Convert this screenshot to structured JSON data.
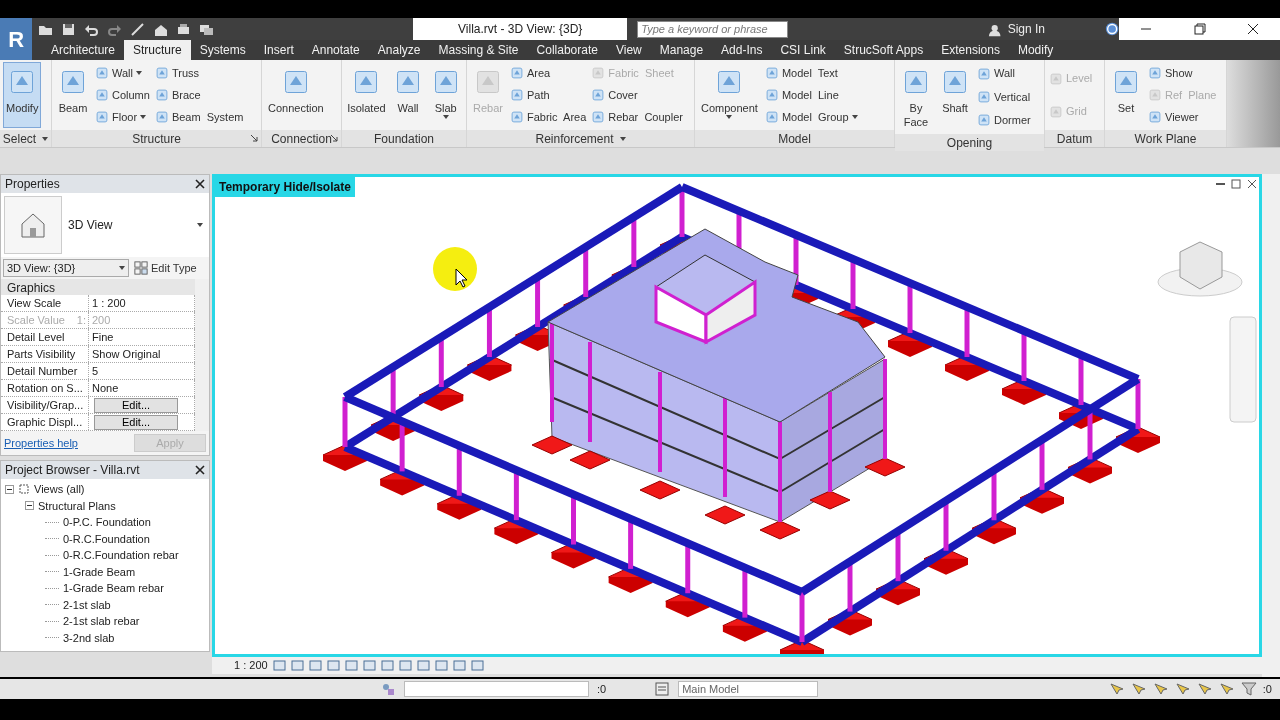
{
  "title_bar": {
    "app_logo": "R",
    "title": "Villa.rvt - 3D View: {3D}",
    "search": {
      "placeholder": "Type a keyword or phrase"
    },
    "sign_in": "Sign In"
  },
  "ribbon_tabs": [
    {
      "label": "Architecture",
      "selected": false
    },
    {
      "label": "Structure",
      "selected": true
    },
    {
      "label": "Systems",
      "selected": false
    },
    {
      "label": "Insert",
      "selected": false
    },
    {
      "label": "Annotate",
      "selected": false
    },
    {
      "label": "Analyze",
      "selected": false
    },
    {
      "label": "Massing & Site",
      "selected": false
    },
    {
      "label": "Collaborate",
      "selected": false
    },
    {
      "label": "View",
      "selected": false
    },
    {
      "label": "Manage",
      "selected": false
    },
    {
      "label": "Add-Ins",
      "selected": false
    },
    {
      "label": "CSI Link",
      "selected": false
    },
    {
      "label": "StrucSoft Apps",
      "selected": false
    },
    {
      "label": "Extensions",
      "selected": false
    },
    {
      "label": "Modify",
      "selected": false
    }
  ],
  "ribbon_panels": [
    {
      "title": "Select",
      "menu": true,
      "tools": [
        {
          "label": "Modify",
          "kind": "large",
          "selected": true
        }
      ]
    },
    {
      "title": "Structure",
      "launcher": true,
      "tools": [
        {
          "label": "Beam",
          "kind": "large"
        },
        {
          "label": "Wall",
          "kind": "small",
          "dropdown": true
        },
        {
          "label": "Column",
          "kind": "small"
        },
        {
          "label": "Floor",
          "kind": "small",
          "dropdown": true
        },
        {
          "label": "Truss",
          "kind": "small"
        },
        {
          "label": "Brace",
          "kind": "small"
        },
        {
          "label": "Beam  System",
          "kind": "small"
        }
      ]
    },
    {
      "title": "Connection",
      "launcher": true,
      "tools": [
        {
          "label": "Connection",
          "kind": "large"
        }
      ]
    },
    {
      "title": "Foundation",
      "tools": [
        {
          "label": "Isolated",
          "kind": "large"
        },
        {
          "label": "Wall",
          "kind": "large"
        },
        {
          "label": "Slab",
          "kind": "large",
          "dropdown": true
        }
      ]
    },
    {
      "title": "Reinforcement",
      "menu": true,
      "tools": [
        {
          "label": "Rebar",
          "kind": "large",
          "disabled": true
        },
        {
          "label": "Area",
          "kind": "small"
        },
        {
          "label": "Path",
          "kind": "small"
        },
        {
          "label": "Fabric  Area",
          "kind": "small"
        },
        {
          "label": "Fabric  Sheet",
          "kind": "small",
          "disabled": true
        },
        {
          "label": "Cover",
          "kind": "small"
        },
        {
          "label": "Rebar  Coupler",
          "kind": "small"
        }
      ]
    },
    {
      "title": "Model",
      "tools": [
        {
          "label": "Component",
          "kind": "large",
          "dropdown": true
        },
        {
          "label": "Model  Text",
          "kind": "small"
        },
        {
          "label": "Model  Line",
          "kind": "small"
        },
        {
          "label": "Model  Group",
          "kind": "small",
          "dropdown": true
        }
      ]
    },
    {
      "title": "Opening",
      "tools": [
        {
          "label": "By Face",
          "kind": "large"
        },
        {
          "label": "Shaft",
          "kind": "large"
        },
        {
          "label": "Wall",
          "kind": "small"
        },
        {
          "label": "Vertical",
          "kind": "small"
        },
        {
          "label": "Dormer",
          "kind": "small"
        }
      ]
    },
    {
      "title": "Datum",
      "tools": [
        {
          "label": "Level",
          "kind": "small",
          "disabled": true
        },
        {
          "label": "Grid",
          "kind": "small",
          "disabled": true
        }
      ]
    },
    {
      "title": "Work Plane",
      "tools": [
        {
          "label": "Set",
          "kind": "large"
        },
        {
          "label": "Show",
          "kind": "small"
        },
        {
          "label": "Ref  Plane",
          "kind": "small",
          "disabled": true
        },
        {
          "label": "Viewer",
          "kind": "small"
        }
      ]
    }
  ],
  "properties": {
    "title": "Properties",
    "type_name": "3D View",
    "type_selector": "3D View: {3D}",
    "edit_type": "Edit Type",
    "group": "Graphics",
    "rows": [
      {
        "name": "View Scale",
        "value": "1 : 200",
        "kind": "text",
        "disabled": false
      },
      {
        "name": "Scale Value",
        "unit": "1:",
        "value": "200",
        "kind": "text",
        "disabled": true
      },
      {
        "name": "Detail Level",
        "value": "Fine",
        "kind": "text",
        "disabled": false
      },
      {
        "name": "Parts Visibility",
        "value": "Show Original",
        "kind": "text",
        "disabled": false
      },
      {
        "name": "Detail Number",
        "value": "5",
        "kind": "text",
        "disabled": false
      },
      {
        "name": "Rotation on S...",
        "value": "None",
        "kind": "text",
        "disabled": false
      },
      {
        "name": "Visibility/Grap...",
        "value": "Edit...",
        "kind": "button",
        "disabled": false
      },
      {
        "name": "Graphic Displ...",
        "value": "Edit...",
        "kind": "button",
        "disabled": false
      }
    ],
    "help_link": "Properties help",
    "apply": {
      "label": "Apply",
      "disabled": true
    }
  },
  "project_browser": {
    "title": "Project Browser - Villa.rvt",
    "tree": [
      {
        "label": "Views (all)",
        "expanded": true,
        "children": [
          {
            "label": "Structural Plans",
            "expanded": true,
            "children": [
              {
                "label": "0-P.C. Foundation"
              },
              {
                "label": "0-R.C.Foundation"
              },
              {
                "label": "0-R.C.Foundation rebar"
              },
              {
                "label": "1-Grade Beam"
              },
              {
                "label": "1-Grade Beam rebar"
              },
              {
                "label": "2-1st slab"
              },
              {
                "label": "2-1st slab rebar"
              },
              {
                "label": "3-2nd slab"
              }
            ]
          }
        ]
      }
    ]
  },
  "viewport": {
    "mode_label": "Temporary Hide/Isolate",
    "scale": "1 : 200"
  },
  "status_bar": {
    "workset_count": ":0",
    "design_option": "Main Model",
    "filter_count": ":0"
  }
}
